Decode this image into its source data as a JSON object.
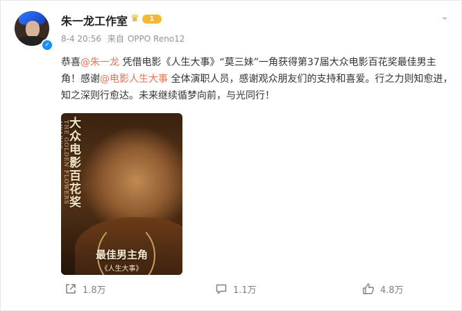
{
  "post": {
    "username": "朱一龙工作室",
    "level": "1",
    "date": "8-4 20:56",
    "source_prefix": "来自",
    "source": "OPPO Reno12",
    "content": {
      "p1": "恭喜",
      "mention1": "@朱一龙",
      "p2": " 凭借电影《人生大事》“莫三妹”一角获得第37届大众电影百花奖最佳男主角！感谢",
      "mention2": "@电影人生大事",
      "p3": " 全体演职人员，感谢观众朋友们的支持和喜爱。行之力则知愈进，知之深则行愈达。未来继续循梦向前，与光同行！"
    },
    "image": {
      "vertical_title": "大众电影百花奖",
      "vertical_subtitle": "THE GOLDEN FLOWERS AWARDS",
      "award": "最佳男主角",
      "film": "《人生大事》"
    }
  },
  "actions": {
    "share_count": "1.8万",
    "comment_count": "1.1万",
    "like_count": "4.8万"
  },
  "colors": {
    "mention": "#eb7350",
    "verify": "#1890ff",
    "badge": "#f4b833"
  },
  "icons": [
    "crown-icon",
    "chevron-down-icon",
    "share-icon",
    "comment-icon",
    "like-icon",
    "verified-icon"
  ]
}
